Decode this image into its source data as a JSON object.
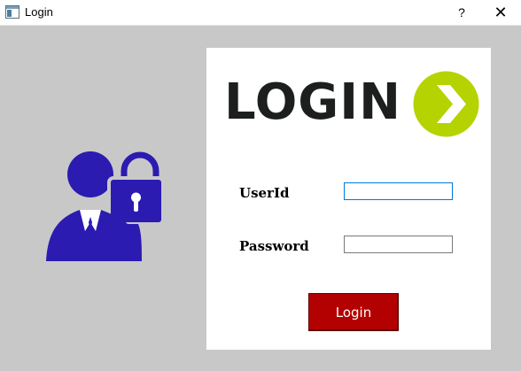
{
  "window": {
    "title": "Login",
    "help_label": "?",
    "close_label": "✕"
  },
  "logo": {
    "text": "LOGIN",
    "arrow_color": "#b5d300"
  },
  "form": {
    "userid_label": "UserId",
    "userid_value": "",
    "password_label": "Password",
    "password_value": "",
    "login_button_label": "Login"
  },
  "colors": {
    "background": "#c8c8c8",
    "icon": "#2b1bb1",
    "button": "#b30000"
  },
  "icons": [
    "app-window-icon",
    "user-lock-icon",
    "login-arrow-icon"
  ]
}
